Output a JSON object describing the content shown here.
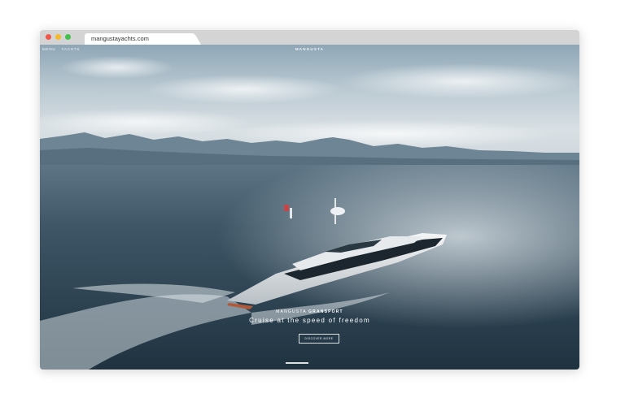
{
  "browser": {
    "url": "mangustayachts.com",
    "traffic_lights": {
      "close": "#f0564a",
      "minimize": "#f5b92d",
      "maximize": "#42c24d"
    }
  },
  "site": {
    "nav": [
      {
        "label": "MENU"
      },
      {
        "label": "YACHTS"
      }
    ],
    "logo": "MANGUSTA"
  },
  "hero": {
    "eyebrow_brand": "MANGUSTA",
    "eyebrow_model": "GRANSPORT",
    "tagline": "Cruise at the speed of freedom",
    "cta_label": "DISCOVER MORE"
  },
  "colors": {
    "sea": "#2f4452",
    "sky": "#c9d4dc",
    "mountains": "#6e8595"
  }
}
